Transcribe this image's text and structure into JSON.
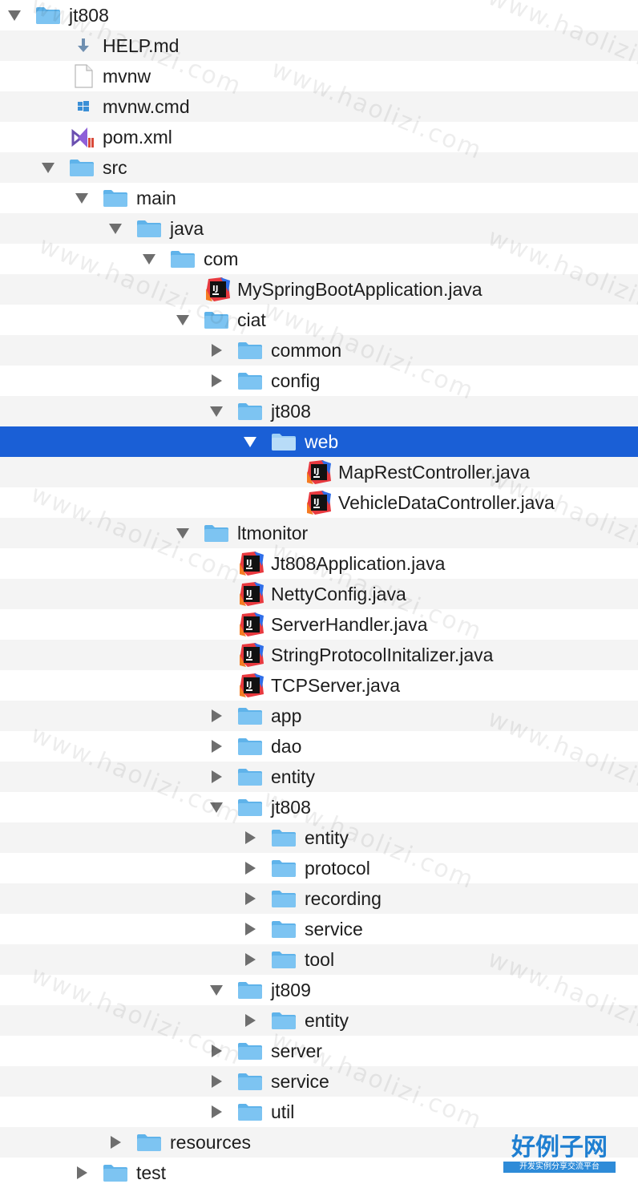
{
  "watermark_text": "www.haolizi.com",
  "logo": {
    "main": "好例子网",
    "sub": "开发实例分享交流平台"
  },
  "tree": [
    {
      "label": "jt808",
      "depth": 0,
      "type": "folder",
      "expanded": true
    },
    {
      "label": "HELP.md",
      "depth": 1,
      "type": "md-file"
    },
    {
      "label": "mvnw",
      "depth": 1,
      "type": "file"
    },
    {
      "label": "mvnw.cmd",
      "depth": 1,
      "type": "cmd-file"
    },
    {
      "label": "pom.xml",
      "depth": 1,
      "type": "xml-file"
    },
    {
      "label": "src",
      "depth": 1,
      "type": "folder",
      "expanded": true
    },
    {
      "label": "main",
      "depth": 2,
      "type": "folder",
      "expanded": true
    },
    {
      "label": "java",
      "depth": 3,
      "type": "folder",
      "expanded": true
    },
    {
      "label": "com",
      "depth": 4,
      "type": "folder",
      "expanded": true
    },
    {
      "label": "MySpringBootApplication.java",
      "depth": 5,
      "type": "java-file"
    },
    {
      "label": "ciat",
      "depth": 5,
      "type": "folder",
      "expanded": true
    },
    {
      "label": "common",
      "depth": 6,
      "type": "folder",
      "expanded": false
    },
    {
      "label": "config",
      "depth": 6,
      "type": "folder",
      "expanded": false
    },
    {
      "label": "jt808",
      "depth": 6,
      "type": "folder",
      "expanded": true
    },
    {
      "label": "web",
      "depth": 7,
      "type": "folder",
      "expanded": true,
      "selected": true
    },
    {
      "label": "MapRestController.java",
      "depth": 8,
      "type": "java-file"
    },
    {
      "label": "VehicleDataController.java",
      "depth": 8,
      "type": "java-file"
    },
    {
      "label": "ltmonitor",
      "depth": 5,
      "type": "folder",
      "expanded": true
    },
    {
      "label": "Jt808Application.java",
      "depth": 6,
      "type": "java-file"
    },
    {
      "label": "NettyConfig.java",
      "depth": 6,
      "type": "java-file"
    },
    {
      "label": "ServerHandler.java",
      "depth": 6,
      "type": "java-file"
    },
    {
      "label": "StringProtocolInitalizer.java",
      "depth": 6,
      "type": "java-file"
    },
    {
      "label": "TCPServer.java",
      "depth": 6,
      "type": "java-file"
    },
    {
      "label": "app",
      "depth": 6,
      "type": "folder",
      "expanded": false
    },
    {
      "label": "dao",
      "depth": 6,
      "type": "folder",
      "expanded": false
    },
    {
      "label": "entity",
      "depth": 6,
      "type": "folder",
      "expanded": false
    },
    {
      "label": "jt808",
      "depth": 6,
      "type": "folder",
      "expanded": true
    },
    {
      "label": "entity",
      "depth": 7,
      "type": "folder",
      "expanded": false
    },
    {
      "label": "protocol",
      "depth": 7,
      "type": "folder",
      "expanded": false
    },
    {
      "label": "recording",
      "depth": 7,
      "type": "folder",
      "expanded": false
    },
    {
      "label": "service",
      "depth": 7,
      "type": "folder",
      "expanded": false
    },
    {
      "label": "tool",
      "depth": 7,
      "type": "folder",
      "expanded": false
    },
    {
      "label": "jt809",
      "depth": 6,
      "type": "folder",
      "expanded": true
    },
    {
      "label": "entity",
      "depth": 7,
      "type": "folder",
      "expanded": false
    },
    {
      "label": "server",
      "depth": 6,
      "type": "folder",
      "expanded": false
    },
    {
      "label": "service",
      "depth": 6,
      "type": "folder",
      "expanded": false
    },
    {
      "label": "util",
      "depth": 6,
      "type": "folder",
      "expanded": false
    },
    {
      "label": "resources",
      "depth": 3,
      "type": "folder",
      "expanded": false
    },
    {
      "label": "test",
      "depth": 2,
      "type": "folder",
      "expanded": false
    }
  ],
  "colors": {
    "selection": "#1a5fd6",
    "folder": "#7dc4f2",
    "stripe": "#f4f4f4"
  }
}
